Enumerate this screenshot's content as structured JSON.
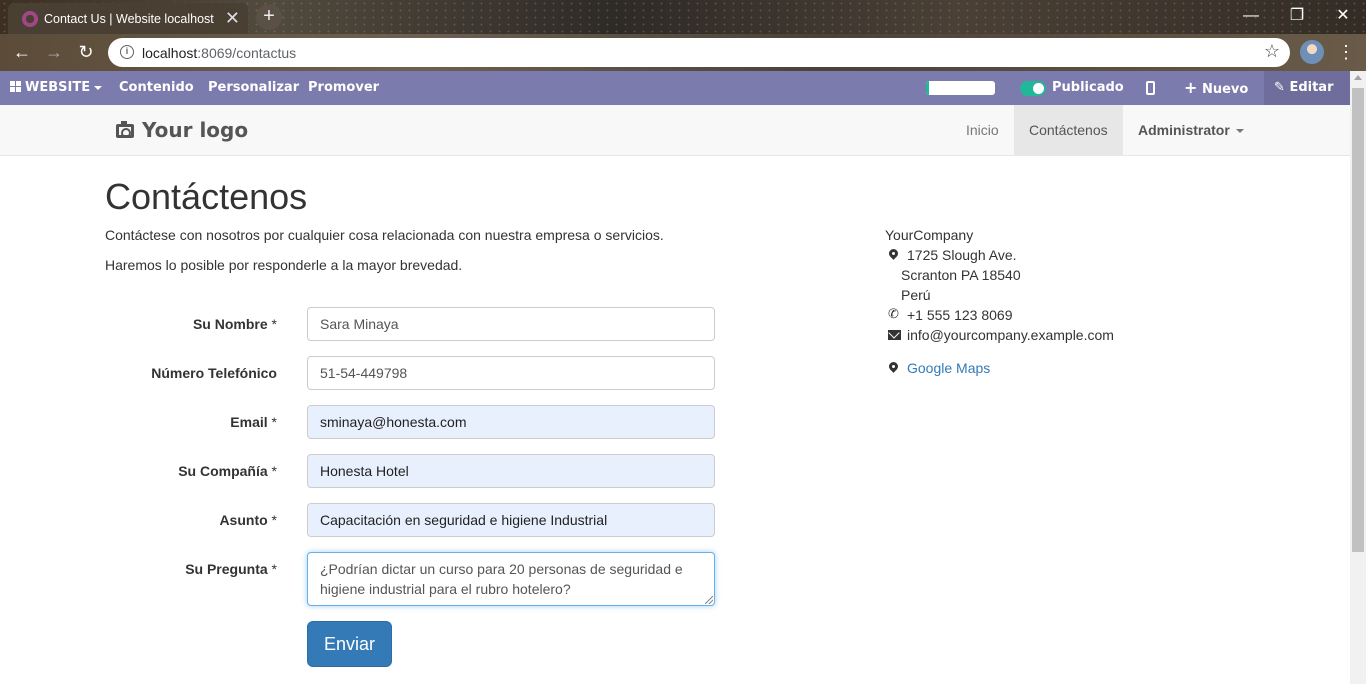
{
  "browser": {
    "tab_title": "Contact Us | Website localhost",
    "tab_close": "✕",
    "new_tab": "+",
    "url_host": "localhost",
    "url_rest": ":8069/contactus",
    "star": "☆",
    "window_min": "—",
    "window_restore": "❐",
    "window_close": "✕",
    "back": "←",
    "forward": "→",
    "reload": "↻",
    "info": "i",
    "menu": "⋮"
  },
  "editbar": {
    "website_label": "WEBSITE",
    "items": [
      "Contenido",
      "Personalizar",
      "Promover"
    ],
    "progress": 0.05,
    "published_label": "Publicado",
    "new_label": "Nuevo",
    "edit_label": "Editar",
    "plus": "+",
    "pencil": "✎"
  },
  "site": {
    "logo_text": "Your logo",
    "menu": [
      "Inicio",
      "Contáctenos",
      "Administrator"
    ],
    "active_menu": "Contáctenos"
  },
  "page": {
    "title": "Contáctenos",
    "intro_1": "Contáctese con nosotros por cualquier cosa relacionada con nuestra empresa o servicios.",
    "intro_2": "Haremos lo posible por responderle a la mayor brevedad."
  },
  "form": {
    "fields": [
      {
        "label": "Su Nombre",
        "required": "*",
        "value": "Sara Minaya"
      },
      {
        "label": "Número Telefónico",
        "required": "",
        "value": "51-54-449798"
      },
      {
        "label": "Email",
        "required": "*",
        "value": "sminaya@honesta.com"
      },
      {
        "label": "Su Compañía",
        "required": "*",
        "value": "Honesta Hotel"
      },
      {
        "label": "Asunto",
        "required": "*",
        "value": "Capacitación en seguridad e higiene Industrial"
      }
    ],
    "question_label": "Su Pregunta",
    "question_required": "*",
    "question_value": "¿Podrían dictar un curso para 20 personas de seguridad e higiene industrial para el rubro hotelero?",
    "submit_label": "Enviar"
  },
  "company": {
    "name": "YourCompany",
    "address_1": "1725 Slough Ave.",
    "address_2": "Scranton PA 18540",
    "address_3": "Perú",
    "phone": "+1 555 123 8069",
    "email": "info@yourcompany.example.com",
    "maps_label": "Google Maps"
  },
  "colors": {
    "editbar": "#7c7bad",
    "accent": "#21b799",
    "primary": "#337ab7"
  }
}
